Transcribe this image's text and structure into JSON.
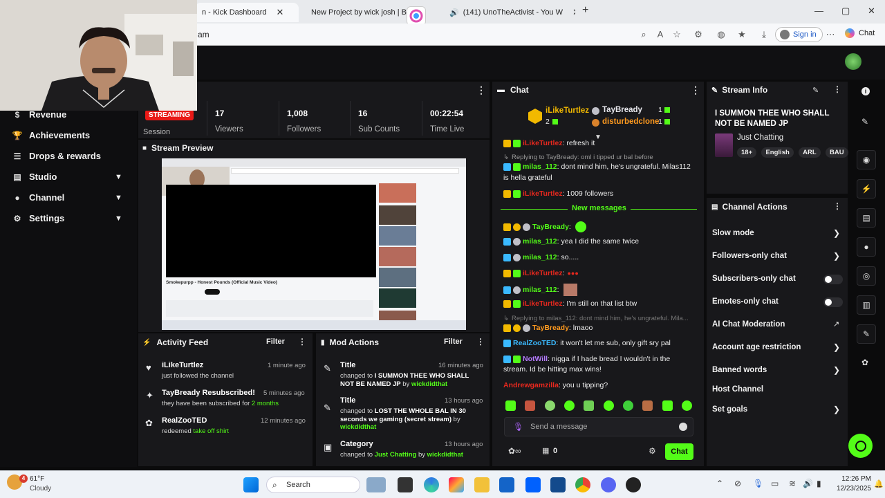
{
  "browser": {
    "tabs": [
      {
        "label": "n - Kick Dashboard"
      },
      {
        "label": "New Project by wick josh | Ba"
      },
      {
        "label": "(141) UnoTheActivist - You W"
      }
    ],
    "url_fragment": "am",
    "signin_label": "Sign in",
    "chat_label": "Chat"
  },
  "sidebar": {
    "items": [
      {
        "label": "Revenue"
      },
      {
        "label": "Achievements"
      },
      {
        "label": "Drops & rewards"
      },
      {
        "label": "Studio"
      },
      {
        "label": "Channel"
      },
      {
        "label": "Settings"
      }
    ]
  },
  "session": {
    "live_badge": "STREAMING",
    "label": "Session",
    "stats": [
      {
        "value": "17",
        "label": "Viewers"
      },
      {
        "value": "1,008",
        "label": "Followers"
      },
      {
        "value": "16",
        "label": "Sub Counts"
      },
      {
        "value": "00:22:54",
        "label": "Time Live"
      }
    ]
  },
  "preview": {
    "title": "Stream Preview",
    "video_title": "Smokepurpp - Honest Pounds (Official Music Video)"
  },
  "activity": {
    "title": "Activity Feed",
    "filter": "Filter",
    "items": [
      {
        "name": "iLikeTurtlez",
        "time": "1 minute ago",
        "text": "just followed the channel",
        "highlight": ""
      },
      {
        "name": "TayBready Resubscribed!",
        "time": "5 minutes ago",
        "text": "they have been subscribed for ",
        "highlight": "2 months"
      },
      {
        "name": "RealZooTED",
        "time": "12 minutes ago",
        "text": "redeemed ",
        "highlight": "take off shirt"
      }
    ]
  },
  "mod": {
    "title": "Mod Actions",
    "filter": "Filter",
    "items": [
      {
        "kind": "Title",
        "time": "16 minutes ago",
        "pre": "changed to ",
        "value": "I SUMMON THEE WHO SHALL NOT BE NAMED JP",
        "by": " by ",
        "user": "wickdidthat"
      },
      {
        "kind": "Title",
        "time": "13 hours ago",
        "pre": "changed to ",
        "value": "LOST THE WHOLE BAL IN 30 seconds we gaming (secret stream)",
        "by": " by ",
        "user": "wickdidthat"
      },
      {
        "kind": "Category",
        "time": "13 hours ago",
        "pre": "changed to ",
        "value": "Just Chatting",
        "by": " by ",
        "user": "wickdidthat"
      }
    ]
  },
  "chat": {
    "title": "Chat",
    "top_gifters": [
      {
        "name": "iLikeTurtlez",
        "count": "2"
      },
      {
        "name": "TayBready",
        "count": "1"
      },
      {
        "name": "disturbedclone",
        "count": "1"
      }
    ],
    "messages": [
      {
        "user": "iLikeTurtlez",
        "text": ": refresh it"
      },
      {
        "reply": "Replying to TayBready: oml i tipped ur bal before"
      },
      {
        "user": "milas_112",
        "text": ": dont mind him, he's ungrateful. Milas112"
      },
      {
        "cont": "is hella grateful"
      },
      {
        "user": "iLikeTurtlez",
        "text": ": 1009 followers"
      },
      {
        "divider": "New messages"
      },
      {
        "user": "TayBready",
        "text": ":"
      },
      {
        "user": "milas_112",
        "text": ": yea I did the same twice"
      },
      {
        "user": "milas_112",
        "text": ": so....."
      },
      {
        "user": "iLikeTurtlez",
        "text": ":"
      },
      {
        "user": "milas_112",
        "text": ":"
      },
      {
        "user": "iLikeTurtlez",
        "text": ": I'm still on that list btw"
      },
      {
        "reply": "Replying to milas_112: dont mind him, he's ungrateful. Mila..."
      },
      {
        "user": "TayBready",
        "text": ": lmaoo"
      },
      {
        "user": "RealZooTED",
        "text": ": it won't let me sub, only gift sry pal"
      },
      {
        "user": "NotWill",
        "text": ": nigga if I hade bread I wouldn't in the"
      },
      {
        "cont": "stream. Id be hitting max wins!"
      },
      {
        "user": "Andrewgamzilla",
        "text": ": you u tipping?"
      }
    ],
    "input_placeholder": "Send a message",
    "viewer_count": "0",
    "send_label": "Chat"
  },
  "stream_info": {
    "title_label": "Stream Info",
    "stream_title": "I SUMMON THEE WHO SHALL NOT BE NAMED JP",
    "category": "Just Chatting",
    "tags": [
      "18+",
      "English",
      "ARL",
      "BAU"
    ]
  },
  "channel_actions": {
    "title": "Channel Actions",
    "items": [
      {
        "label": "Slow mode",
        "control": "chevron"
      },
      {
        "label": "Followers-only chat",
        "control": "chevron"
      },
      {
        "label": "Subscribers-only chat",
        "control": "toggle"
      },
      {
        "label": "Emotes-only chat",
        "control": "toggle"
      },
      {
        "label": "AI Chat Moderation",
        "control": "external"
      },
      {
        "label": "Account age restriction",
        "control": "chevron"
      },
      {
        "label": "Banned words",
        "control": "chevron"
      },
      {
        "label": "Host Channel",
        "control": "none"
      },
      {
        "label": "Set goals",
        "control": "chevron"
      }
    ]
  },
  "taskbar": {
    "weather_temp": "61°F",
    "weather_desc": "Cloudy",
    "weather_badge": "4",
    "search_label": "Search",
    "time": "12:26 PM",
    "date": "12/23/2025"
  },
  "colors": {
    "brand": "#53fc18",
    "live": "#e91916",
    "panel": "#18181b"
  }
}
